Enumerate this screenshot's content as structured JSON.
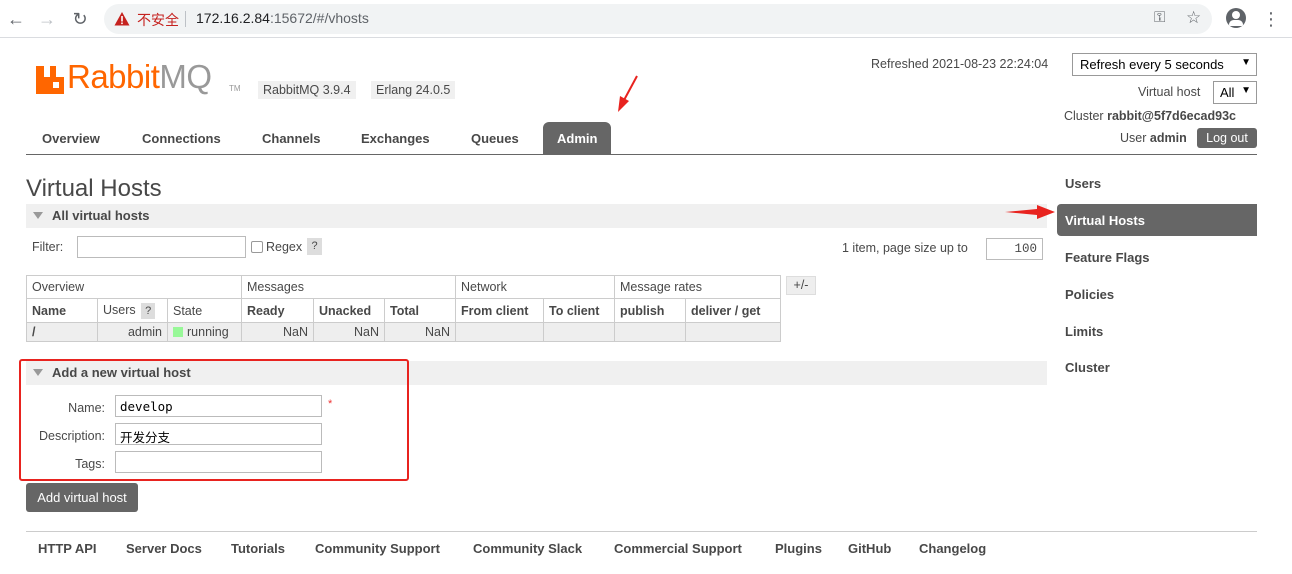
{
  "browser": {
    "security_label": "不安全",
    "url_host": "172.16.2.84",
    "url_rest": ":15672/#/vhosts"
  },
  "app": {
    "logo_rabbit": "Rabbit",
    "logo_mq": "MQ",
    "logo_tm": "TM",
    "version": "RabbitMQ 3.9.4",
    "erlang": "Erlang 24.0.5"
  },
  "header": {
    "refreshed": "Refreshed 2021-08-23 22:24:04",
    "refresh_select": "Refresh every 5 seconds",
    "vhost_label": "Virtual host",
    "vhost_select": "All",
    "cluster_label": "Cluster",
    "cluster_name": "rabbit@5f7d6ecad93c",
    "user_label": "User",
    "user_name": "admin",
    "logout": "Log out"
  },
  "tabs": [
    "Overview",
    "Connections",
    "Channels",
    "Exchanges",
    "Queues",
    "Admin"
  ],
  "active_tab": "Admin",
  "page": {
    "title": "Virtual Hosts",
    "section_all": "All virtual hosts",
    "filter_label": "Filter:",
    "regex_label": "Regex",
    "help": "?",
    "page_info": "1 item, page size up to",
    "page_size": "100",
    "plus_minus": "+/-"
  },
  "table": {
    "groups": [
      "Overview",
      "Messages",
      "Network",
      "Message rates"
    ],
    "columns": [
      "Name",
      "Users",
      "State",
      "Ready",
      "Unacked",
      "Total",
      "From client",
      "To client",
      "publish",
      "deliver / get"
    ],
    "users_help": "?",
    "rows": [
      {
        "name": "/",
        "users": "admin",
        "state": "running",
        "ready": "NaN",
        "unacked": "NaN",
        "total": "NaN",
        "from_client": "",
        "to_client": "",
        "publish": "",
        "deliver_get": ""
      }
    ]
  },
  "add_form": {
    "section_title": "Add a new virtual host",
    "name_label": "Name:",
    "name_value": "develop",
    "required_mark": "*",
    "description_label": "Description:",
    "description_value": "开发分支",
    "tags_label": "Tags:",
    "tags_value": "",
    "submit": "Add virtual host"
  },
  "sidebar": {
    "items": [
      "Users",
      "Virtual Hosts",
      "Feature Flags",
      "Policies",
      "Limits",
      "Cluster"
    ],
    "active": "Virtual Hosts"
  },
  "footer": {
    "links": [
      "HTTP API",
      "Server Docs",
      "Tutorials",
      "Community Support",
      "Community Slack",
      "Commercial Support",
      "Plugins",
      "GitHub",
      "Changelog"
    ]
  },
  "colors": {
    "brand_orange": "#ff6600",
    "tab_active_bg": "#666666",
    "annotation_red": "#e8231f",
    "running_green": "#98f898"
  }
}
